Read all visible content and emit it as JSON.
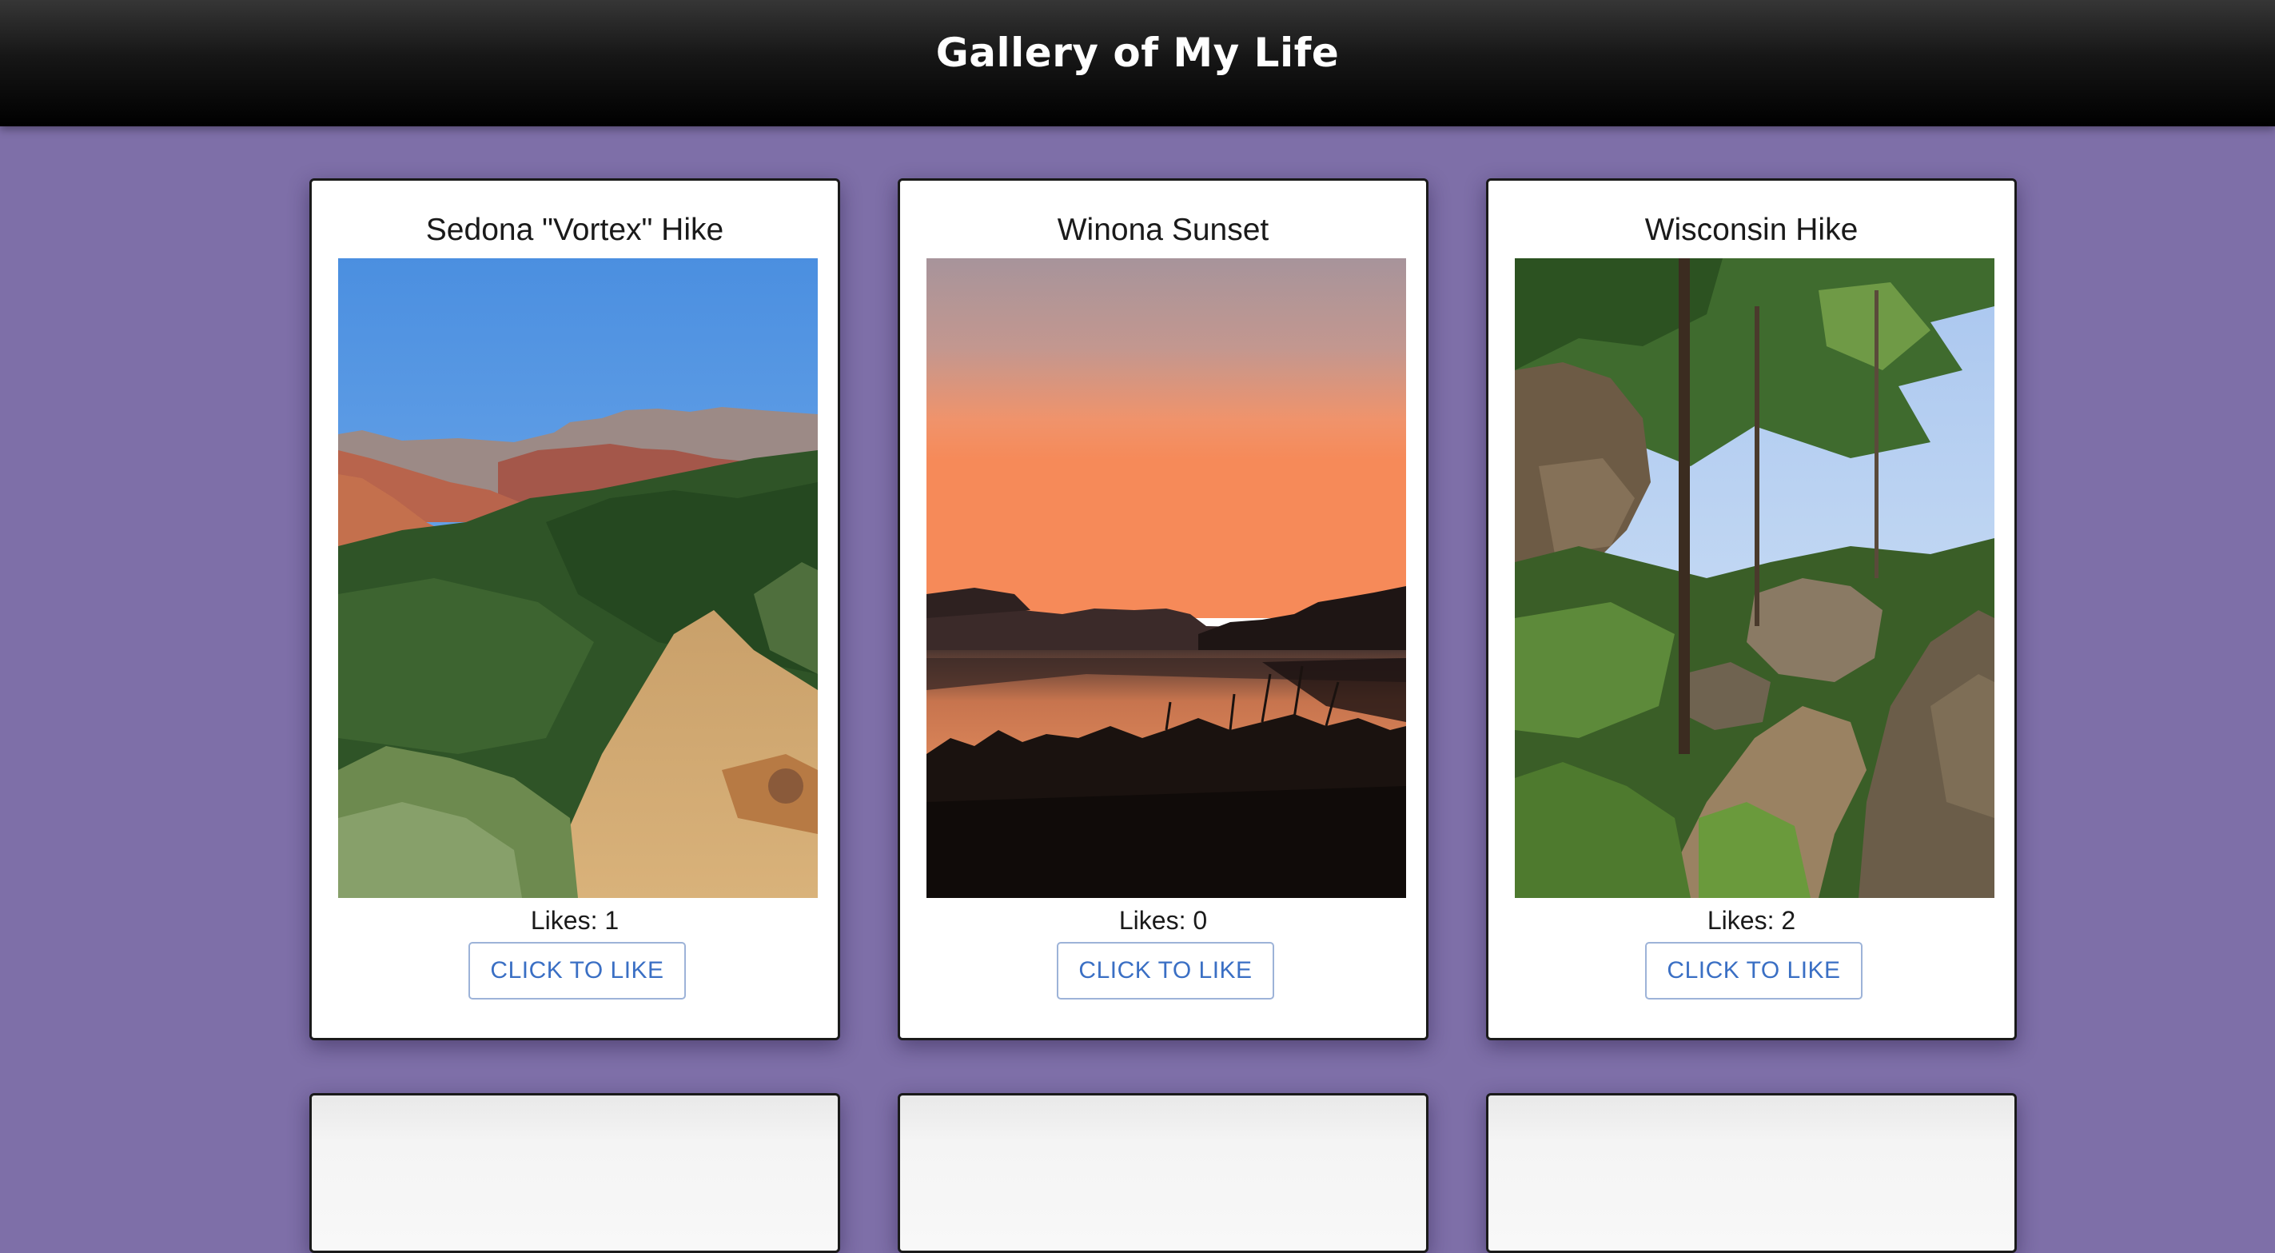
{
  "header": {
    "title": "Gallery of My Life"
  },
  "cards": [
    {
      "title": "Sedona \"Vortex\" Hike",
      "likes_text": "Likes: 1",
      "button_label": "CLICK TO LIKE",
      "image_name": "sedona-hike-photo"
    },
    {
      "title": "Winona Sunset",
      "likes_text": "Likes: 0",
      "button_label": "CLICK TO LIKE",
      "image_name": "winona-sunset-photo"
    },
    {
      "title": "Wisconsin Hike",
      "likes_text": "Likes: 2",
      "button_label": "CLICK TO LIKE",
      "image_name": "wisconsin-hike-photo"
    }
  ],
  "colors": {
    "background": "#7e6fa8",
    "header_top": "#363636",
    "header_bottom": "#000000",
    "button_text": "#3a6fc4",
    "button_border": "#9db3d8"
  }
}
